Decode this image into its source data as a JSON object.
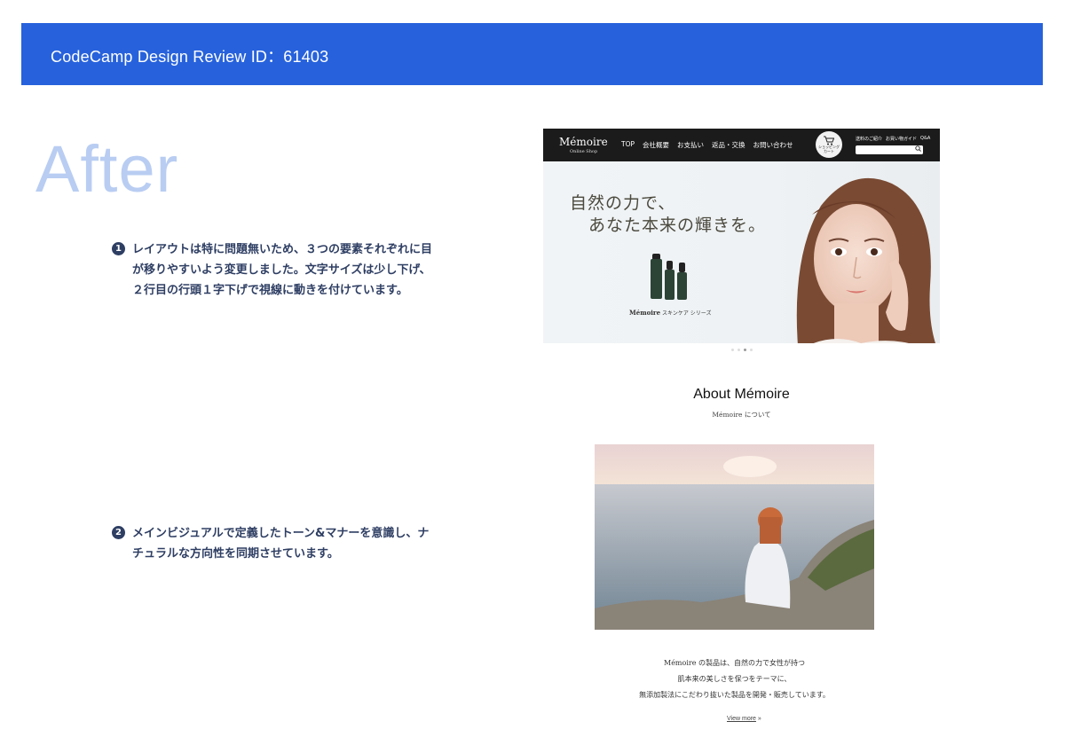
{
  "banner": {
    "title": "CodeCamp Design Review ID：61403"
  },
  "section_title": "After",
  "notes": [
    {
      "number": "1",
      "text": "レイアウトは特に問題無いため、３つの要素それぞれに目が移りやすいよう変更しました。文字サイズは少し下げ、２行目の行頭１字下げで視線に動きを付けています。"
    },
    {
      "number": "2",
      "text": "メインビジュアルで定義したトーン&マナーを意識し、ナチュラルな方向性を同期させています。"
    }
  ],
  "site": {
    "logo": "Mémoire",
    "logo_sub": "Online Shop",
    "nav": [
      "TOP",
      "会社概要",
      "お支払い",
      "返品・交換",
      "お問い合わせ"
    ],
    "cart": {
      "icon": "cart-icon",
      "label": "ショッピングカート"
    },
    "util_links": [
      "送料のご紹介",
      "お買い物ガイド",
      "Q&A"
    ],
    "search": {
      "icon": "search-icon",
      "placeholder": ""
    },
    "hero": {
      "line1": "自然の力で、",
      "line2": "あなた本来の輝きを。",
      "series_brand": "Mémoire",
      "series_text": "スキンケア シリーズ",
      "slider_count": 4,
      "slider_active": 3
    },
    "about": {
      "title": "About Mémoire",
      "subtitle": "Mémoire について",
      "body": [
        "Mémoire の製品は、自然の力で女性が持つ",
        "肌本来の美しさを保つをテーマに、",
        "無添加製法にこだわり抜いた製品を開発・販売しています。"
      ],
      "view_more": "View more",
      "view_more_icon": "double-chevron-right-icon"
    }
  },
  "colors": {
    "banner": "#2762dc",
    "after_title": "#b9cdf2",
    "note_text": "#2e3e63",
    "site_header": "#1b1b1b"
  }
}
